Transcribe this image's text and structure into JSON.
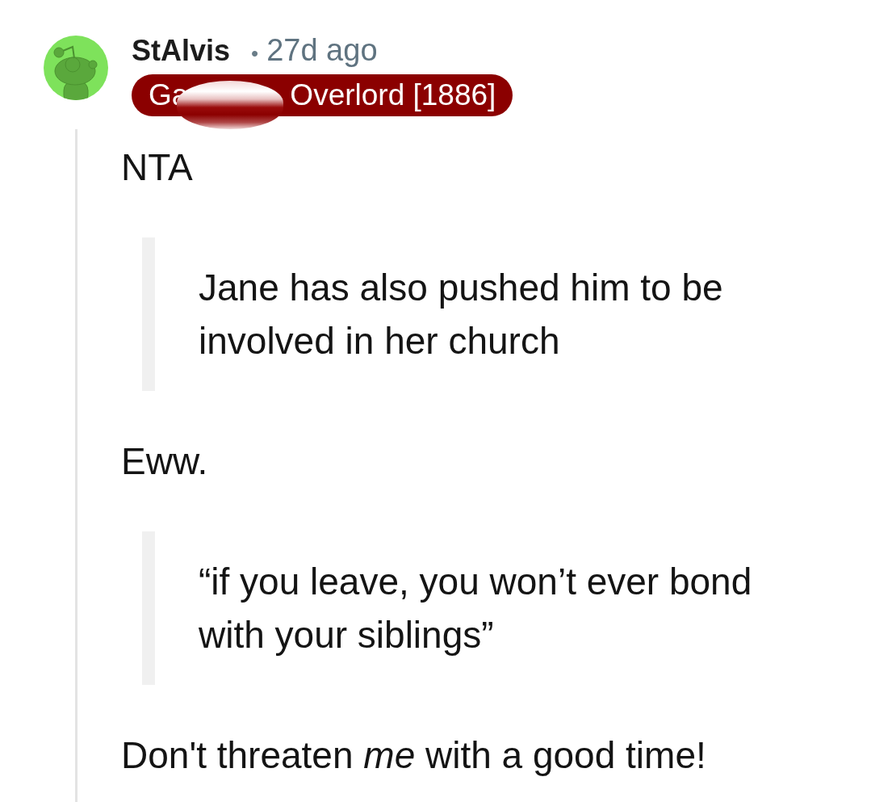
{
  "comment": {
    "author": "StAlvis",
    "separator": "•",
    "age": "27d ago",
    "flair": {
      "parts": [
        "Ga",
        "Overlord [1886]"
      ],
      "redacted": true
    }
  },
  "body": [
    {
      "kind": "paragraph",
      "text": "NTA"
    },
    {
      "kind": "quote",
      "text": "Jane has also pushed him to be involved in her church"
    },
    {
      "kind": "paragraph",
      "text": "Eww."
    },
    {
      "kind": "quote",
      "text": "“if you leave, you won’t ever bond with your siblings”"
    },
    {
      "kind": "paragraph",
      "text": "Don't threaten *me* with a good time!"
    }
  ]
}
